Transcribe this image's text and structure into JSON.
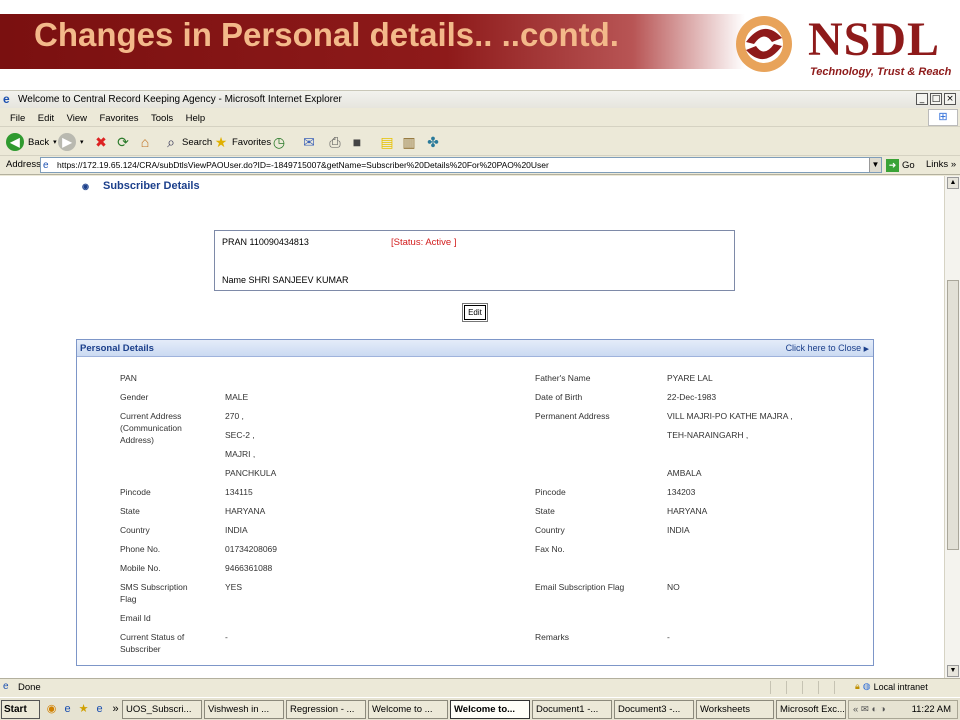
{
  "slide": {
    "title": "Changes in Personal details.. ..contd.",
    "logo_text": "NSDL",
    "logo_tagline": "Technology, Trust & Reach",
    "colors": {
      "bar": "#8e1a1a",
      "title": "#f3b98a",
      "logo": "#8e1a1a"
    }
  },
  "browser": {
    "window_title": "Welcome to Central Record Keeping Agency - Microsoft Internet Explorer",
    "menus": [
      "File",
      "Edit",
      "View",
      "Favorites",
      "Tools",
      "Help"
    ],
    "toolbar": {
      "back": "Back",
      "search": "Search",
      "favorites": "Favorites"
    },
    "address_label": "Address",
    "address_url": "https://172.19.65.124/CRA/subDtlsViewPAOUser.do?ID=-1849715007&getName=Subscriber%20Details%20For%20PAO%20User",
    "go_label": "Go",
    "links_label": "Links",
    "status_text": "Done",
    "zone_label": "Local intranet"
  },
  "page": {
    "section_heading": "Subscriber Details",
    "pran_label": "PRAN  110090434813",
    "status_label": "[Status: Active ]",
    "name_label": "Name  SHRI  SANJEEV KUMAR",
    "edit_button": "Edit",
    "panel_title": "Personal Details",
    "panel_close": "Click here to Close"
  },
  "details": {
    "left": {
      "pan": "PAN",
      "gender_label": "Gender",
      "gender": "MALE",
      "curr_addr_label": "Current Address (Communication Address)",
      "curr_addr": [
        "270 ,",
        "SEC-2 ,",
        "MAJRI ,",
        "PANCHKULA"
      ],
      "pincode_label": "Pincode",
      "pincode": "134115",
      "state_label": "State",
      "state": "HARYANA",
      "country_label": "Country",
      "country": "INDIA",
      "phone_label": "Phone No.",
      "phone": "01734208069",
      "mobile_label": "Mobile No.",
      "mobile": "9466361088",
      "sms_label": "SMS Subscription Flag",
      "sms": "YES",
      "email_label": "Email Id",
      "curr_status_label": "Current Status of Subscriber",
      "curr_status": "-"
    },
    "right": {
      "father_label": "Father's Name",
      "father": "PYARE LAL",
      "dob_label": "Date of Birth",
      "dob": "22-Dec-1983",
      "perm_addr_label": "Permanent Address",
      "perm_addr": [
        "VILL MAJRI-PO KATHE MAJRA ,",
        "TEH-NARAINGARH ,",
        "",
        "AMBALA"
      ],
      "pincode_label": "Pincode",
      "pincode": "134203",
      "state_label": "State",
      "state": "HARYANA",
      "country_label": "Country",
      "country": "INDIA",
      "fax_label": "Fax No.",
      "email_flag_label": "Email Subscription Flag",
      "email_flag": "NO",
      "remarks_label": "Remarks",
      "remarks": "-"
    }
  },
  "taskbar": {
    "start": "Start",
    "tasks": [
      "UOS_Subscri...",
      "Vishwesh in ...",
      "Regression - ...",
      "Welcome to ...",
      "Welcome to...",
      "Document1 -...",
      "Document3 -...",
      "Worksheets",
      "Microsoft Exc..."
    ],
    "clock": "11:22 AM"
  }
}
